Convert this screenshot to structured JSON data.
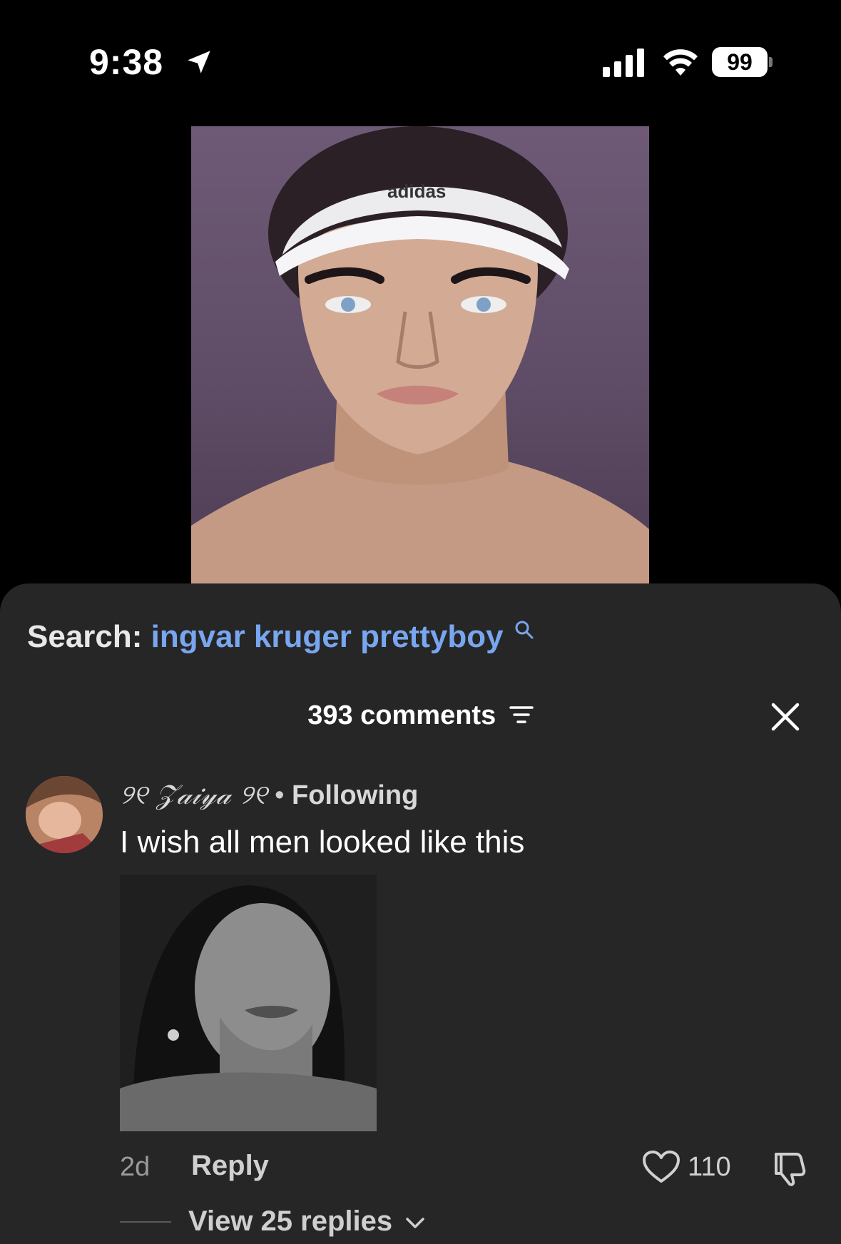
{
  "status_bar": {
    "time": "9:38",
    "battery": "99",
    "icons": [
      "location-arrow-icon",
      "cellular-signal-icon",
      "wifi-icon",
      "battery-icon"
    ]
  },
  "post": {
    "image_desc": "photo-icon",
    "visor_text": "adidas"
  },
  "search": {
    "label": "Search:",
    "query": "ingvar kruger prettyboy"
  },
  "comments": {
    "header": "393 comments",
    "close": "close-icon",
    "items": [
      {
        "username": "୨୧ 𝒵𝒶𝒾𝓎𝒶 ୨୧",
        "separator": "•",
        "following": "Following",
        "text": "I wish all men looked like this",
        "time": "2d",
        "reply_label": "Reply",
        "likes": "110",
        "view_replies": "View 25 replies"
      }
    ]
  },
  "colors": {
    "sheet_bg": "#262626",
    "accent_link": "#78a6ef",
    "muted_text": "#9a9a9a"
  }
}
